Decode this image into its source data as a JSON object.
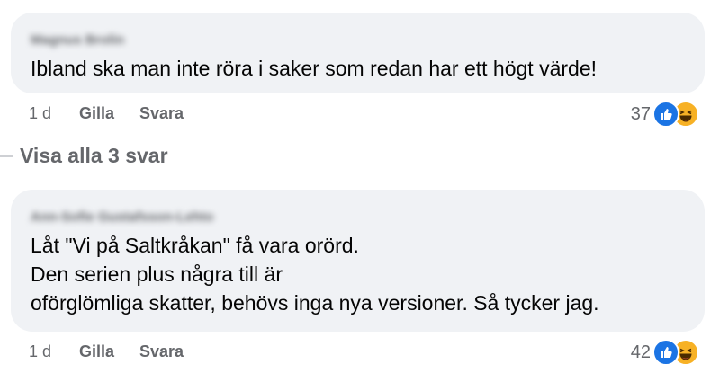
{
  "comments": [
    {
      "author": "Magnus Brolin",
      "lines": [
        "Ibland ska man inte röra i saker som redan har ett högt värde!"
      ],
      "time": "1 d",
      "like_label": "Gilla",
      "reply_label": "Svara",
      "reaction_count": "37",
      "reaction_icons": [
        "like-icon",
        "haha-icon"
      ]
    },
    {
      "author": "Ann-Sofie Gustafsson-Lehto",
      "lines": [
        "Låt \"Vi på Saltkråkan\" få vara orörd.",
        "Den serien plus några till är",
        "oförglömliga skatter, behövs inga nya versioner. Så tycker jag."
      ],
      "time": "1 d",
      "like_label": "Gilla",
      "reply_label": "Svara",
      "reaction_count": "42",
      "reaction_icons": [
        "like-icon",
        "haha-icon"
      ]
    }
  ],
  "view_replies": "Visa alla 3 svar",
  "colors": {
    "bubble": "#f0f2f5",
    "text": "#050505",
    "secondary": "#65676b",
    "like_blue": "#1b74e4",
    "haha_yellow": "#f7b125"
  }
}
